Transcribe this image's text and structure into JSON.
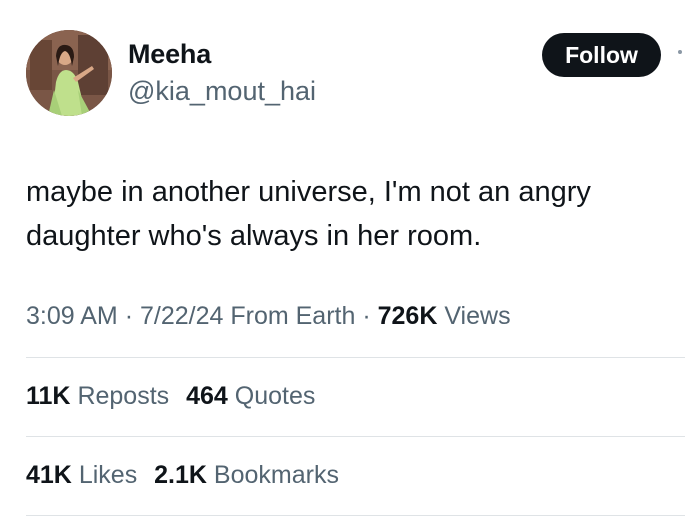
{
  "author": {
    "name": "Meeha",
    "handle": "@kia_mout_hai"
  },
  "follow_button": {
    "label": "Follow"
  },
  "tweet": {
    "text": "maybe in another universe, I'm not an angry daughter who's always in her room."
  },
  "meta": {
    "time": "3:09 AM",
    "separator": "·",
    "date": "7/22/24",
    "source": "From Earth",
    "views_count": "726K",
    "views_label": "Views"
  },
  "stats": {
    "reposts_count": "11K",
    "reposts_label": "Reposts",
    "quotes_count": "464",
    "quotes_label": "Quotes",
    "likes_count": "41K",
    "likes_label": "Likes",
    "bookmarks_count": "2.1K",
    "bookmarks_label": "Bookmarks"
  },
  "colors": {
    "text_primary": "#0f1419",
    "text_secondary": "#536471",
    "button_bg": "#0f1419",
    "divider": "#dfe3e6"
  }
}
